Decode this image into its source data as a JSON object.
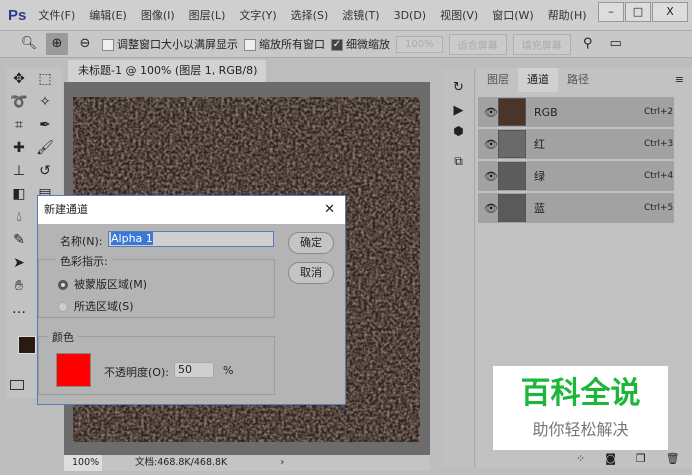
{
  "app": {
    "logo": "Ps",
    "menus": [
      "文件(F)",
      "编辑(E)",
      "图像(I)",
      "图层(L)",
      "文字(Y)",
      "选择(S)",
      "滤镜(T)",
      "3D(D)",
      "视图(V)",
      "窗口(W)",
      "帮助(H)"
    ],
    "min": "–",
    "max": "□",
    "close": "X"
  },
  "options": {
    "resize_windows": "调整窗口大小以满屏显示",
    "zoom_all": "缩放所有窗口",
    "scrubby": "细微缩放",
    "zoom_pct": "100%",
    "fit_screen": "适合屏幕",
    "fill_screen": "填充屏幕"
  },
  "document": {
    "tab": "未标题-1 @ 100% (图层 1, RGB/8) *",
    "tab_close": "×",
    "zoom": "100%",
    "doc_info": "文档:468.8K/468.8K",
    "arrow": "›"
  },
  "panel": {
    "tabs": [
      "图层",
      "通道",
      "路径"
    ],
    "channels": [
      {
        "name": "RGB",
        "shortcut": "Ctrl+2",
        "color": "#4a3528"
      },
      {
        "name": "红",
        "shortcut": "Ctrl+3",
        "color": "#6a6a6a"
      },
      {
        "name": "绿",
        "shortcut": "Ctrl+4",
        "color": "#5c5c5c"
      },
      {
        "name": "蓝",
        "shortcut": "Ctrl+5",
        "color": "#5a5a5a"
      }
    ]
  },
  "dialog": {
    "title": "新建通道",
    "close": "✕",
    "name_label": "名称(N):",
    "name_value": "Alpha 1",
    "color_indicates": "色彩指示:",
    "masked": "被蒙版区域(M)",
    "selected": "所选区域(S)",
    "color_group": "颜色",
    "opacity_label": "不透明度(O):",
    "opacity_value": "50",
    "percent": "%",
    "ok": "确定",
    "cancel": "取消",
    "swatch": "#ff0000"
  },
  "watermark": {
    "title": "百科全说",
    "subtitle": "助你轻松解决"
  }
}
